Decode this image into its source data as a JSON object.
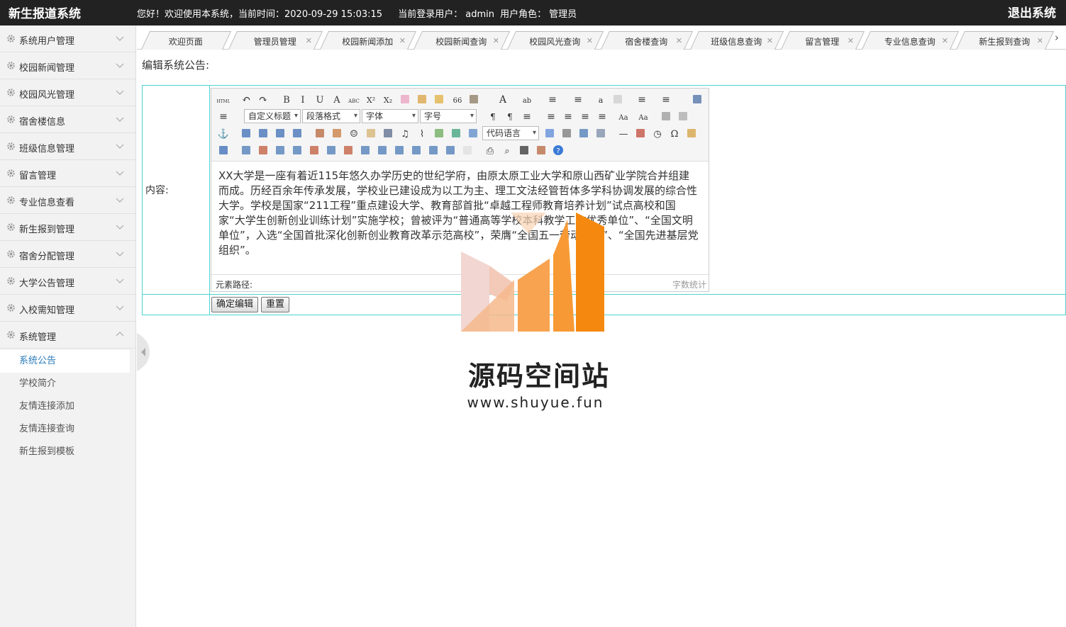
{
  "app": {
    "title": "新生报道系统",
    "welcome": "您好！欢迎使用本系统，当前时间：2020-09-29 15:03:15",
    "user_label": "当前登录用户：",
    "user": "admin",
    "role_label": "用户角色：",
    "role": "管理员",
    "logout": "退出系统"
  },
  "sidebar": {
    "items": [
      {
        "label": "系统用户管理"
      },
      {
        "label": "校园新闻管理"
      },
      {
        "label": "校园风光管理"
      },
      {
        "label": "宿舍楼信息"
      },
      {
        "label": "班级信息管理"
      },
      {
        "label": "留言管理"
      },
      {
        "label": "专业信息查看"
      },
      {
        "label": "新生报到管理"
      },
      {
        "label": "宿舍分配管理"
      },
      {
        "label": "大学公告管理"
      },
      {
        "label": "入校需知管理"
      },
      {
        "label": "系统管理"
      }
    ],
    "submenu": [
      {
        "label": "系统公告",
        "active": true
      },
      {
        "label": "学校简介"
      },
      {
        "label": "友情连接添加"
      },
      {
        "label": "友情连接查询"
      },
      {
        "label": "新生报到模板"
      }
    ]
  },
  "tabs": [
    {
      "label": "欢迎页面",
      "closable": false
    },
    {
      "label": "管理员管理",
      "closable": true
    },
    {
      "label": "校园新闻添加",
      "closable": true
    },
    {
      "label": "校园新闻查询",
      "closable": true
    },
    {
      "label": "校园风光查询",
      "closable": true
    },
    {
      "label": "宿舍楼查询",
      "closable": true
    },
    {
      "label": "班级信息查询",
      "closable": true
    },
    {
      "label": "留言管理",
      "closable": true
    },
    {
      "label": "专业信息查询",
      "closable": true
    },
    {
      "label": "新生报到查询",
      "closable": true
    }
  ],
  "page": {
    "heading": "编辑系统公告:",
    "content_label": "内容:",
    "editor": {
      "selects": {
        "custom_heading": "自定义标题",
        "paragraph": "段落格式",
        "font": "字体",
        "size": "字号",
        "code_lang": "代码语言"
      },
      "content": "XX大学是一座有着近115年悠久办学历史的世纪学府，由原太原工业大学和原山西矿业学院合并组建而成。历经百余年传承发展，学校业已建设成为以工为主、理工文法经管哲体多学科协调发展的综合性大学。学校是国家“211工程”重点建设大学、教育部首批“卓越工程师教育培养计划”试点高校和国家“大学生创新创业训练计划”实施学校；曾被评为“普通高等学校本科教学工作优秀单位”、“全国文明单位”，入选“全国首批深化创新创业教育改革示范高校”，荣膺“全国五一劳动奖状”、“全国先进基层党组织”。",
      "element_path": "元素路径:",
      "word_count": "字数统计"
    },
    "confirm_button": "确定编辑",
    "reset_button": "重置"
  },
  "watermark": {
    "name": "源码空间站",
    "url": "www.shuyue.fun"
  },
  "colors": {
    "topbar": "#222222",
    "sidebar": "#f2f2f2",
    "active_sub": "#2a7ab8",
    "table_border": "#4fd3d3",
    "watermark_orange": "#f5890f"
  }
}
